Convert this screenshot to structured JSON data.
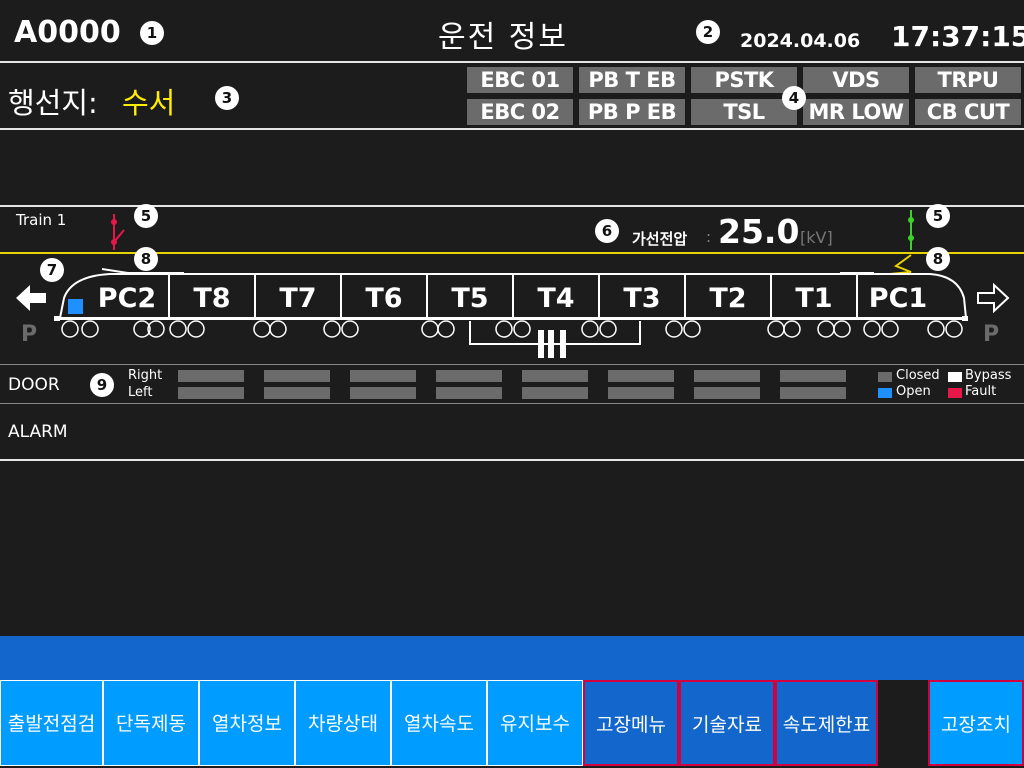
{
  "header": {
    "train_id": "A0000",
    "title": "운전 정보",
    "date": "2024.04.06",
    "time": "17:37:15"
  },
  "callouts": [
    "1",
    "2",
    "3",
    "4",
    "5",
    "5",
    "6",
    "7",
    "8",
    "8",
    "9"
  ],
  "destination": {
    "label": "행선지:",
    "value": "수서"
  },
  "indicators": [
    "EBC 01",
    "PB T EB",
    "PSTK",
    "VDS",
    "TRPU",
    "EBC 02",
    "PB P EB",
    "TSL",
    "MR LOW",
    "CB CUT"
  ],
  "train": {
    "name": "Train 1",
    "catenary_label": "가선전압",
    "catenary_sep": ":",
    "catenary_value": "25.0",
    "catenary_unit": "[kV]",
    "cars": [
      "PC2",
      "T8",
      "T7",
      "T6",
      "T5",
      "T4",
      "T3",
      "T2",
      "T1",
      "PC1"
    ],
    "left_park": "P",
    "right_park": "P",
    "left_arrow": "left-arrow-filled",
    "right_arrow": "right-arrow-outline"
  },
  "door": {
    "label": "DOOR",
    "right": "Right",
    "left": "Left"
  },
  "legend": {
    "closed": "Closed",
    "bypass": "Bypass",
    "open": "Open",
    "fault": "Fault",
    "colors": {
      "closed": "#6b6b6b",
      "bypass": "#ffffff",
      "open": "#1e90ff",
      "fault": "#e8174a"
    }
  },
  "alarm": {
    "label": "ALARM"
  },
  "menu": [
    "출발전점검",
    "단독제동",
    "열차정보",
    "차량상태",
    "열차속도",
    "유지보수",
    "고장메뉴",
    "기술자료",
    "속도제한표",
    "",
    "고장조치"
  ]
}
